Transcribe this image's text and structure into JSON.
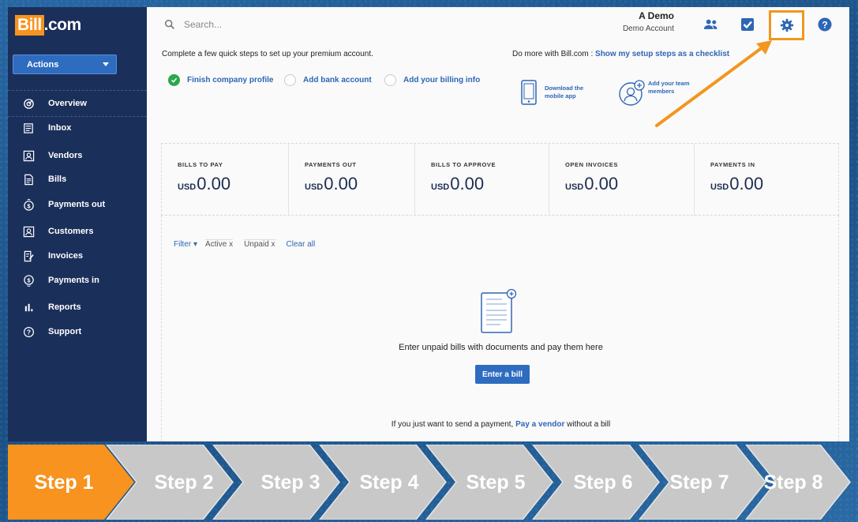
{
  "logo": {
    "part1": "Bill",
    "part2": ".com"
  },
  "sidebar": {
    "actions_label": "Actions",
    "items": [
      {
        "label": "Overview",
        "icon": "overview-icon"
      },
      {
        "label": "Inbox",
        "icon": "inbox-icon"
      },
      {
        "label": "Vendors",
        "icon": "vendors-icon"
      },
      {
        "label": "Bills",
        "icon": "bills-icon"
      },
      {
        "label": "Payments out",
        "icon": "payments-out-icon"
      },
      {
        "label": "Customers",
        "icon": "customers-icon"
      },
      {
        "label": "Invoices",
        "icon": "invoices-icon"
      },
      {
        "label": "Payments in",
        "icon": "payments-in-icon"
      },
      {
        "label": "Reports",
        "icon": "reports-icon"
      },
      {
        "label": "Support",
        "icon": "support-icon"
      }
    ]
  },
  "header": {
    "search_placeholder": "Search...",
    "user_name": "A Demo",
    "account_name": "Demo Account"
  },
  "setup": {
    "message": "Complete a few quick steps to set up your premium account.",
    "domore_prefix": "Do more with Bill.com : ",
    "domore_link": "Show my setup steps as a checklist",
    "steps": [
      {
        "label": "Finish company profile",
        "done": true
      },
      {
        "label": "Add bank account",
        "done": false
      },
      {
        "label": "Add your billing info",
        "done": false
      }
    ],
    "promo_mobile_line1": "Download the",
    "promo_mobile_line2": "mobile app",
    "promo_team_line1": "Add your team",
    "promo_team_line2": "members"
  },
  "stats": [
    {
      "label": "BILLS TO PAY",
      "currency": "USD",
      "value": "0.00"
    },
    {
      "label": "PAYMENTS OUT",
      "currency": "USD",
      "value": "0.00"
    },
    {
      "label": "BILLS TO APPROVE",
      "currency": "USD",
      "value": "0.00"
    },
    {
      "label": "OPEN INVOICES",
      "currency": "USD",
      "value": "0.00"
    },
    {
      "label": "PAYMENTS IN",
      "currency": "USD",
      "value": "0.00"
    }
  ],
  "filters": {
    "filter_label": "Filter",
    "chip1": "Active",
    "chip2": "Unpaid",
    "chip_close": "x",
    "clear_all": "Clear all"
  },
  "empty_state": {
    "message": "Enter unpaid bills with documents and pay them here",
    "button": "Enter a bill",
    "pay_prefix": "If you just want to send a payment, ",
    "pay_link": "Pay a vendor",
    "pay_suffix": " without a bill"
  },
  "steps_bar": {
    "items": [
      "Step 1",
      "Step 2",
      "Step 3",
      "Step 4",
      "Step 5",
      "Step 6",
      "Step 7",
      "Step 8"
    ],
    "active_index": 0,
    "active_color": "#f7931e",
    "inactive_color": "#c8c8c8"
  },
  "colors": {
    "sidebar": "#1b2f5b",
    "accent": "#2e6cc0",
    "highlight": "#f2961f"
  }
}
